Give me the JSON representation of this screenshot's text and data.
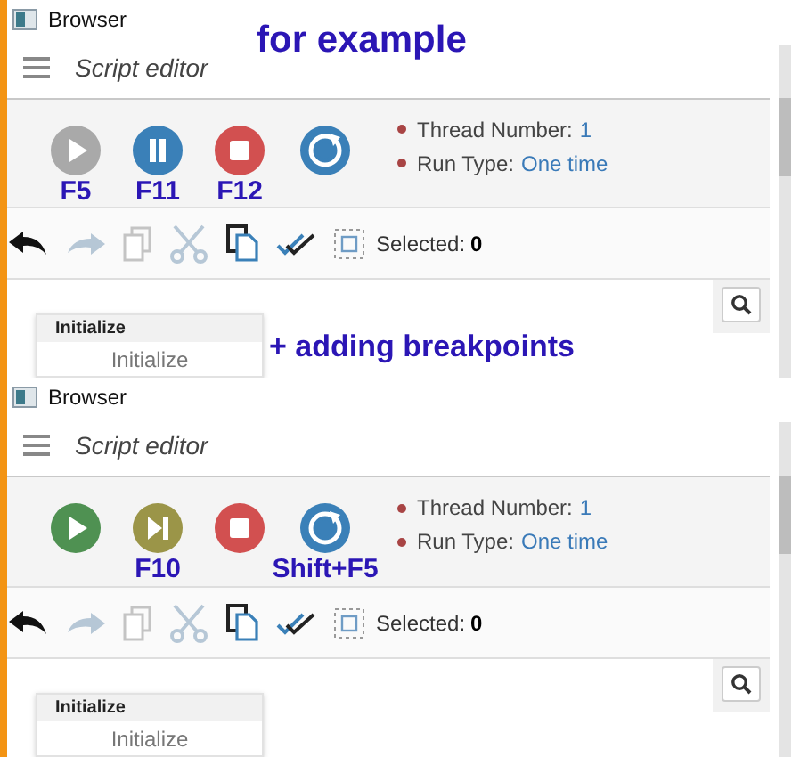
{
  "panels": [
    {
      "window": {
        "title": "Browser"
      },
      "header": {
        "title": "Script editor"
      },
      "annotation": "for example",
      "run_buttons": [
        {
          "kind": "play",
          "disabled": true,
          "shortcut": "F5"
        },
        {
          "kind": "pause",
          "disabled": false,
          "shortcut": "F11"
        },
        {
          "kind": "stop",
          "disabled": false,
          "shortcut": "F12"
        },
        {
          "kind": "refresh",
          "disabled": false
        }
      ],
      "info": [
        {
          "label": "Thread Number:",
          "value": "1"
        },
        {
          "label": "Run Type:",
          "value": "One time"
        }
      ],
      "tools": [
        {
          "kind": "undo",
          "disabled": false
        },
        {
          "kind": "redo",
          "disabled": true
        },
        {
          "kind": "copy",
          "disabled": true
        },
        {
          "kind": "cut",
          "disabled": true
        },
        {
          "kind": "paste",
          "disabled": false
        },
        {
          "kind": "check",
          "disabled": false
        },
        {
          "kind": "select",
          "disabled": false
        }
      ],
      "selected": {
        "label": "Selected:",
        "value": "0"
      },
      "node": {
        "header": "Initialize",
        "body": "Initialize"
      },
      "note": "+ adding breakpoints"
    },
    {
      "window": {
        "title": "Browser"
      },
      "header": {
        "title": "Script editor"
      },
      "run_buttons": [
        {
          "kind": "play",
          "disabled": false
        },
        {
          "kind": "step",
          "disabled": false,
          "shortcut": "F10"
        },
        {
          "kind": "stop",
          "disabled": false
        },
        {
          "kind": "refresh",
          "disabled": false,
          "shortcut": "Shift+F5"
        }
      ],
      "info": [
        {
          "label": "Thread Number:",
          "value": "1"
        },
        {
          "label": "Run Type:",
          "value": "One time"
        }
      ],
      "tools": [
        {
          "kind": "undo",
          "disabled": false
        },
        {
          "kind": "redo",
          "disabled": true
        },
        {
          "kind": "copy",
          "disabled": true
        },
        {
          "kind": "cut",
          "disabled": true
        },
        {
          "kind": "paste",
          "disabled": false
        },
        {
          "kind": "check",
          "disabled": false
        },
        {
          "kind": "select",
          "disabled": false
        }
      ],
      "selected": {
        "label": "Selected:",
        "value": "0"
      },
      "node": {
        "header": "Initialize",
        "body": "Initialize"
      }
    }
  ]
}
